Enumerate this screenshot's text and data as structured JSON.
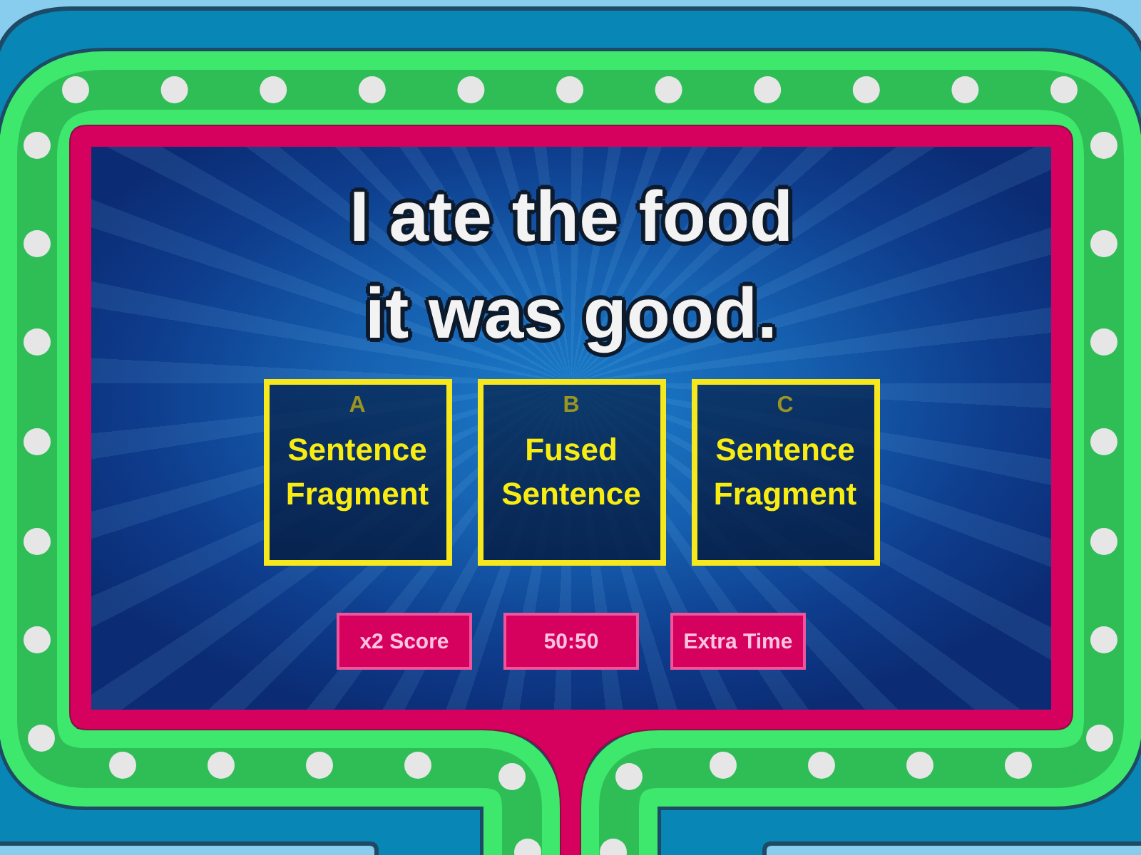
{
  "question": "I ate the food it was good.",
  "answers": [
    {
      "letter": "A",
      "text": "Sentence Fragment"
    },
    {
      "letter": "B",
      "text": "Fused Sentence"
    },
    {
      "letter": "C",
      "text": "Sentence Fragment"
    }
  ],
  "lifelines": [
    "x2 Score",
    "50:50",
    "Extra Time"
  ]
}
